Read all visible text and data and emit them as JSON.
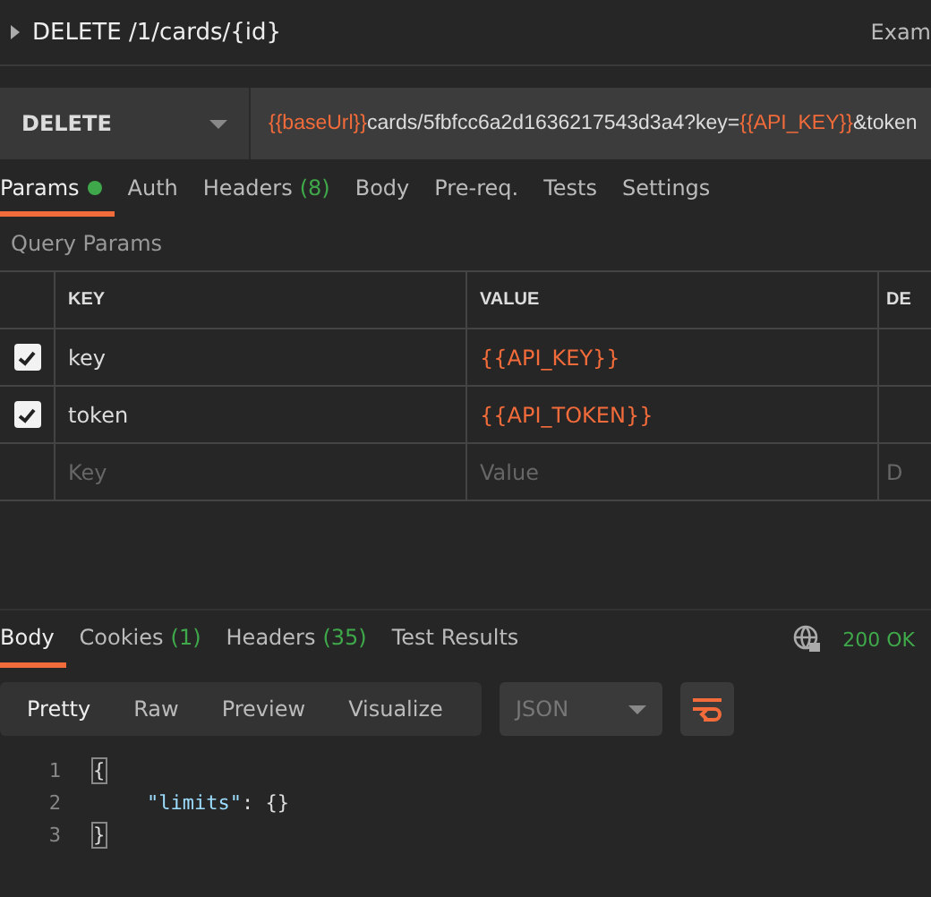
{
  "request": {
    "title": "DELETE /1/cards/{id}",
    "right_label": "Exam",
    "method": "DELETE",
    "url": [
      {
        "kind": "var",
        "text": "{{baseUrl}}"
      },
      {
        "kind": "text",
        "text": "cards/5fbfcc6a2d1636217543d3a4?key="
      },
      {
        "kind": "var",
        "text": "{{API_KEY}}"
      },
      {
        "kind": "text",
        "text": "&token"
      }
    ]
  },
  "request_tabs": [
    {
      "label": "Params",
      "dot": true,
      "selected": true
    },
    {
      "label": "Auth",
      "dot": false,
      "selected": false
    },
    {
      "label": "Headers",
      "count": "(8)",
      "dot": false,
      "selected": false
    },
    {
      "label": "Body",
      "dot": false,
      "selected": false
    },
    {
      "label": "Pre-req.",
      "dot": false,
      "selected": false
    },
    {
      "label": "Tests",
      "dot": false,
      "selected": false
    },
    {
      "label": "Settings",
      "dot": false,
      "selected": false
    }
  ],
  "query_params": {
    "title": "Query Params",
    "columns": [
      "KEY",
      "VALUE",
      "DE"
    ],
    "rows": [
      {
        "checked": true,
        "key": "key",
        "value": "{{API_KEY}}"
      },
      {
        "checked": true,
        "key": "token",
        "value": "{{API_TOKEN}}"
      }
    ],
    "placeholders": {
      "key": "Key",
      "value": "Value",
      "description": "D"
    }
  },
  "response_tabs": [
    {
      "label": "Body",
      "selected": true
    },
    {
      "label": "Cookies",
      "count": "(1)",
      "selected": false
    },
    {
      "label": "Headers",
      "count": "(35)",
      "selected": false
    },
    {
      "label": "Test Results",
      "selected": false
    }
  ],
  "status": "200 OK",
  "view_modes": [
    {
      "label": "Pretty",
      "selected": true
    },
    {
      "label": "Raw",
      "selected": false
    },
    {
      "label": "Preview",
      "selected": false
    },
    {
      "label": "Visualize",
      "selected": false
    }
  ],
  "format": "JSON",
  "code": [
    {
      "number": "1",
      "kind": "brace",
      "text": "{"
    },
    {
      "number": "2",
      "kind": "pair",
      "key": "\"limits\"",
      "text": ": {}"
    },
    {
      "number": "3",
      "kind": "brace",
      "text": "}"
    }
  ]
}
